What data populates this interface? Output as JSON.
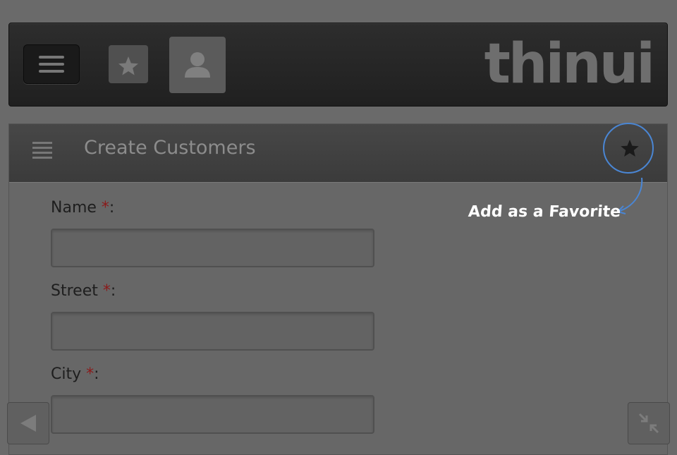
{
  "app": {
    "logo_text": "thinui"
  },
  "topbar": {
    "menu_icon": "hamburger-menu-icon",
    "favorites_icon": "star-icon",
    "user_icon": "user-icon"
  },
  "panel": {
    "title": "Create Customers",
    "list_icon": "list-icon",
    "favorite_icon": "star-icon",
    "annotation": "Add as a Favorite"
  },
  "form": {
    "fields": [
      {
        "label": "Name",
        "required_mark": "*",
        "suffix": ":",
        "value": ""
      },
      {
        "label": "Street",
        "required_mark": "*",
        "suffix": ":",
        "value": ""
      },
      {
        "label": "City",
        "required_mark": "*",
        "suffix": ":",
        "value": ""
      }
    ]
  },
  "footer": {
    "back_icon": "back-arrow-icon",
    "collapse_icon": "collapse-arrows-icon"
  },
  "colors": {
    "background": "#6a6a6a",
    "topbar": "#262626",
    "required": "#8b1a1a",
    "highlight_circle": "#4a86d4"
  }
}
